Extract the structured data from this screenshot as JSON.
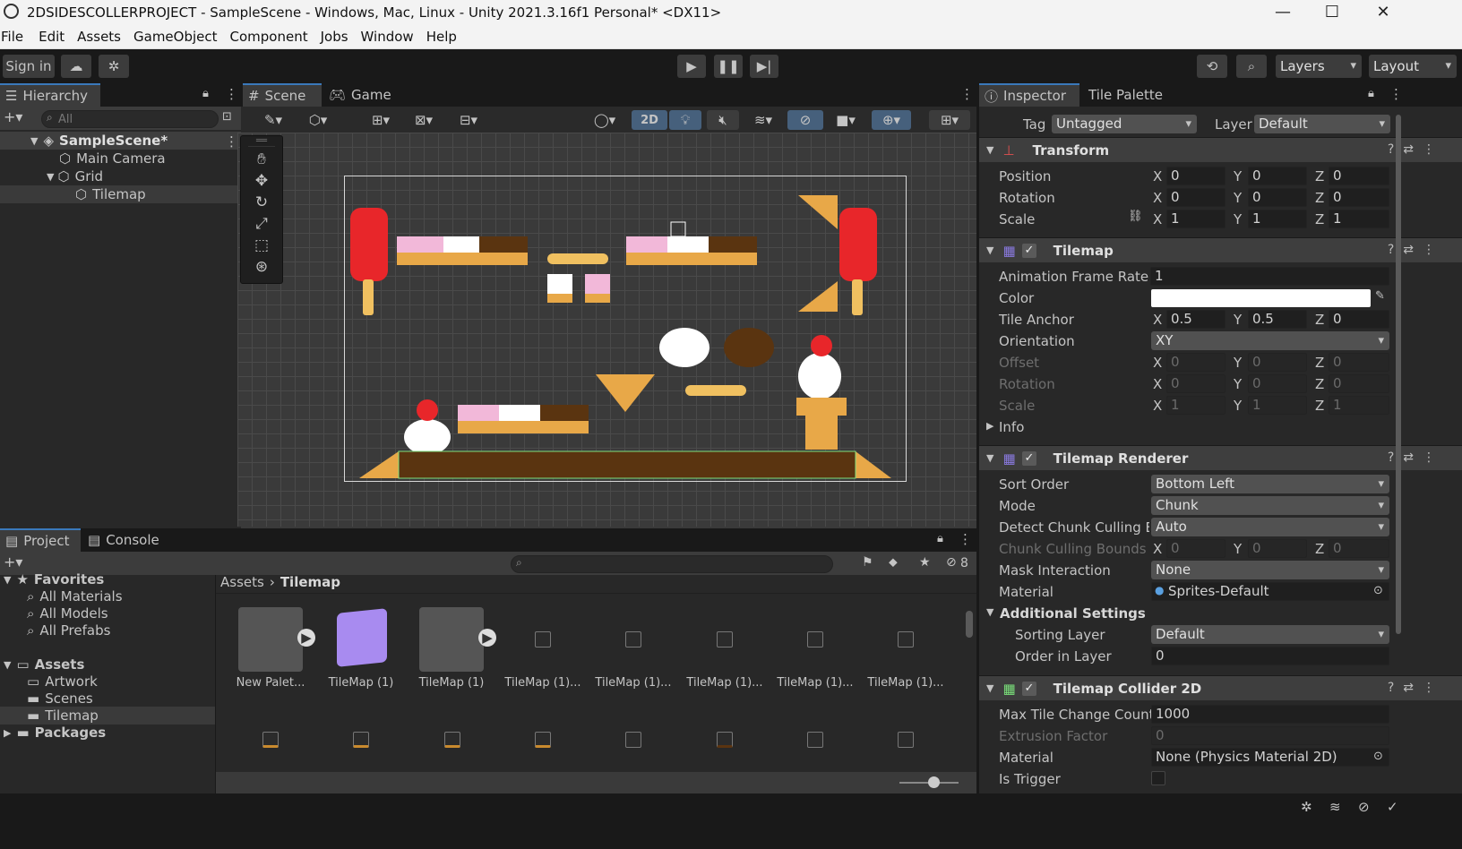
{
  "window": {
    "title": "2DSIDESCOLLERPROJECT - SampleScene - Windows, Mac, Linux - Unity 2021.3.16f1 Personal* <DX11>"
  },
  "menu": [
    "File",
    "Edit",
    "Assets",
    "GameObject",
    "Component",
    "Jobs",
    "Window",
    "Help"
  ],
  "toolbar": {
    "sign_in": "Sign in",
    "layers": "Layers",
    "layout": "Layout"
  },
  "hierarchy": {
    "tab": "Hierarchy",
    "search_placeholder": "All",
    "scene": "SampleScene*",
    "items": [
      "Main Camera",
      "Grid",
      "Tilemap"
    ]
  },
  "scene_view": {
    "tab_scene": "Scene",
    "tab_game": "Game",
    "mode_2d": "2D"
  },
  "inspector": {
    "tab": "Inspector",
    "tab2": "Tile Palette",
    "tag_label": "Tag",
    "tag_value": "Untagged",
    "layer_label": "Layer",
    "layer_value": "Default",
    "transform": {
      "title": "Transform",
      "position": {
        "label": "Position",
        "x": "0",
        "y": "0",
        "z": "0"
      },
      "rotation": {
        "label": "Rotation",
        "x": "0",
        "y": "0",
        "z": "0"
      },
      "scale": {
        "label": "Scale",
        "x": "1",
        "y": "1",
        "z": "1"
      }
    },
    "tilemap": {
      "title": "Tilemap",
      "frame_rate_label": "Animation Frame Rate",
      "frame_rate": "1",
      "color_label": "Color",
      "anchor_label": "Tile Anchor",
      "anchor_x": "0.5",
      "anchor_y": "0.5",
      "anchor_z": "0",
      "orientation_label": "Orientation",
      "orientation": "XY",
      "offset_label": "Offset",
      "offset": [
        "0",
        "0",
        "0"
      ],
      "rotation_label": "Rotation",
      "rotation": [
        "0",
        "0",
        "0"
      ],
      "scale_label": "Scale",
      "scale": [
        "1",
        "1",
        "1"
      ],
      "info_label": "Info"
    },
    "renderer": {
      "title": "Tilemap Renderer",
      "sort_order_label": "Sort Order",
      "sort_order": "Bottom Left",
      "mode_label": "Mode",
      "mode": "Chunk",
      "detect_label": "Detect Chunk Culling Bc",
      "detect": "Auto",
      "bounds_label": "Chunk Culling Bounds",
      "bounds": [
        "0",
        "0",
        "0"
      ],
      "mask_label": "Mask Interaction",
      "mask": "None",
      "material_label": "Material",
      "material": "Sprites-Default",
      "additional_label": "Additional Settings",
      "sorting_layer_label": "Sorting Layer",
      "sorting_layer": "Default",
      "order_label": "Order in Layer",
      "order": "0"
    },
    "collider": {
      "title": "Tilemap Collider 2D",
      "max_label": "Max Tile Change Count",
      "max": "1000",
      "extrusion_label": "Extrusion Factor",
      "extrusion": "0",
      "material_label": "Material",
      "material": "None (Physics Material 2D)",
      "trigger_label": "Is Trigger"
    }
  },
  "project": {
    "tab": "Project",
    "tab2": "Console",
    "hidden_count": "8",
    "favorites": "Favorites",
    "fav_items": [
      "All Materials",
      "All Models",
      "All Prefabs"
    ],
    "assets": "Assets",
    "asset_folders": [
      "Artwork",
      "Scenes",
      "Tilemap"
    ],
    "packages": "Packages",
    "breadcrumb_root": "Assets",
    "breadcrumb_current": "Tilemap",
    "assets_row1": [
      "New Palet...",
      "TileMap (1)",
      "TileMap (1)",
      "TileMap (1)...",
      "TileMap (1)...",
      "TileMap (1)...",
      "TileMap (1)...",
      "TileMap (1)..."
    ]
  },
  "axis_labels": {
    "x": "X",
    "y": "Y",
    "z": "Z"
  }
}
